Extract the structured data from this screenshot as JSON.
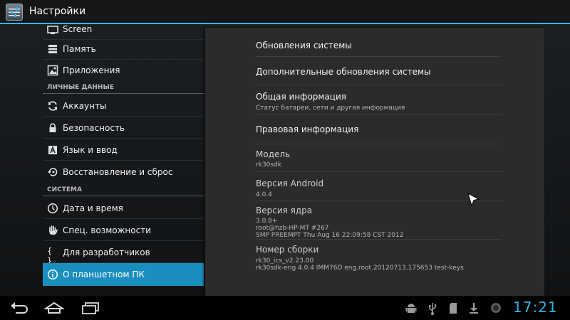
{
  "actionbar": {
    "title": "Настройки"
  },
  "sidebar": {
    "items": [
      {
        "label": "Screen",
        "icon": "screen-icon"
      },
      {
        "label": "Память",
        "icon": "storage-icon"
      },
      {
        "label": "Приложения",
        "icon": "apps-icon"
      },
      {
        "label": "Аккаунты",
        "icon": "sync-icon"
      },
      {
        "label": "Безопасность",
        "icon": "lock-icon"
      },
      {
        "label": "Язык и ввод",
        "icon": "keyboard-icon"
      },
      {
        "label": "Восстановление и сброс",
        "icon": "restore-icon"
      },
      {
        "label": "Дата и время",
        "icon": "clock-icon"
      },
      {
        "label": "Спец. возможности",
        "icon": "hand-icon"
      },
      {
        "label": "Для разработчиков",
        "icon": "braces-icon"
      },
      {
        "label": "О планшетном ПК",
        "icon": "info-icon",
        "selected": true
      }
    ],
    "sections": [
      "ЛИЧНЫЕ ДАННЫЕ",
      "СИСТЕМА"
    ]
  },
  "about": {
    "system_updates": "Обновления системы",
    "extra_updates": "Дополнительные обновления системы",
    "status_title": "Общая информация",
    "status_sub": "Статус батареи, сети и другая информация",
    "legal": "Правовая информация",
    "model_title": "Модель",
    "model_value": "rk30sdk",
    "android_title": "Версия Android",
    "android_value": "4.0.4",
    "kernel_title": "Версия ядра",
    "kernel_line1": "3.0.8+",
    "kernel_line2": "root@hzb-HP-MT #267",
    "kernel_line3": "SMP PREEMPT Thu Aug 16 22:09:58 CST 2012",
    "build_title": "Номер сборки",
    "build_line1": "rk30_ics_v2.23.00",
    "build_line2": "rk30sdk-eng 4.0.4 IMM76D eng.root.20120713.175653 test-keys"
  },
  "systembar": {
    "clock": "17:21"
  },
  "colors": {
    "accent": "#33b5e5",
    "selected": "#1a8fbf"
  }
}
